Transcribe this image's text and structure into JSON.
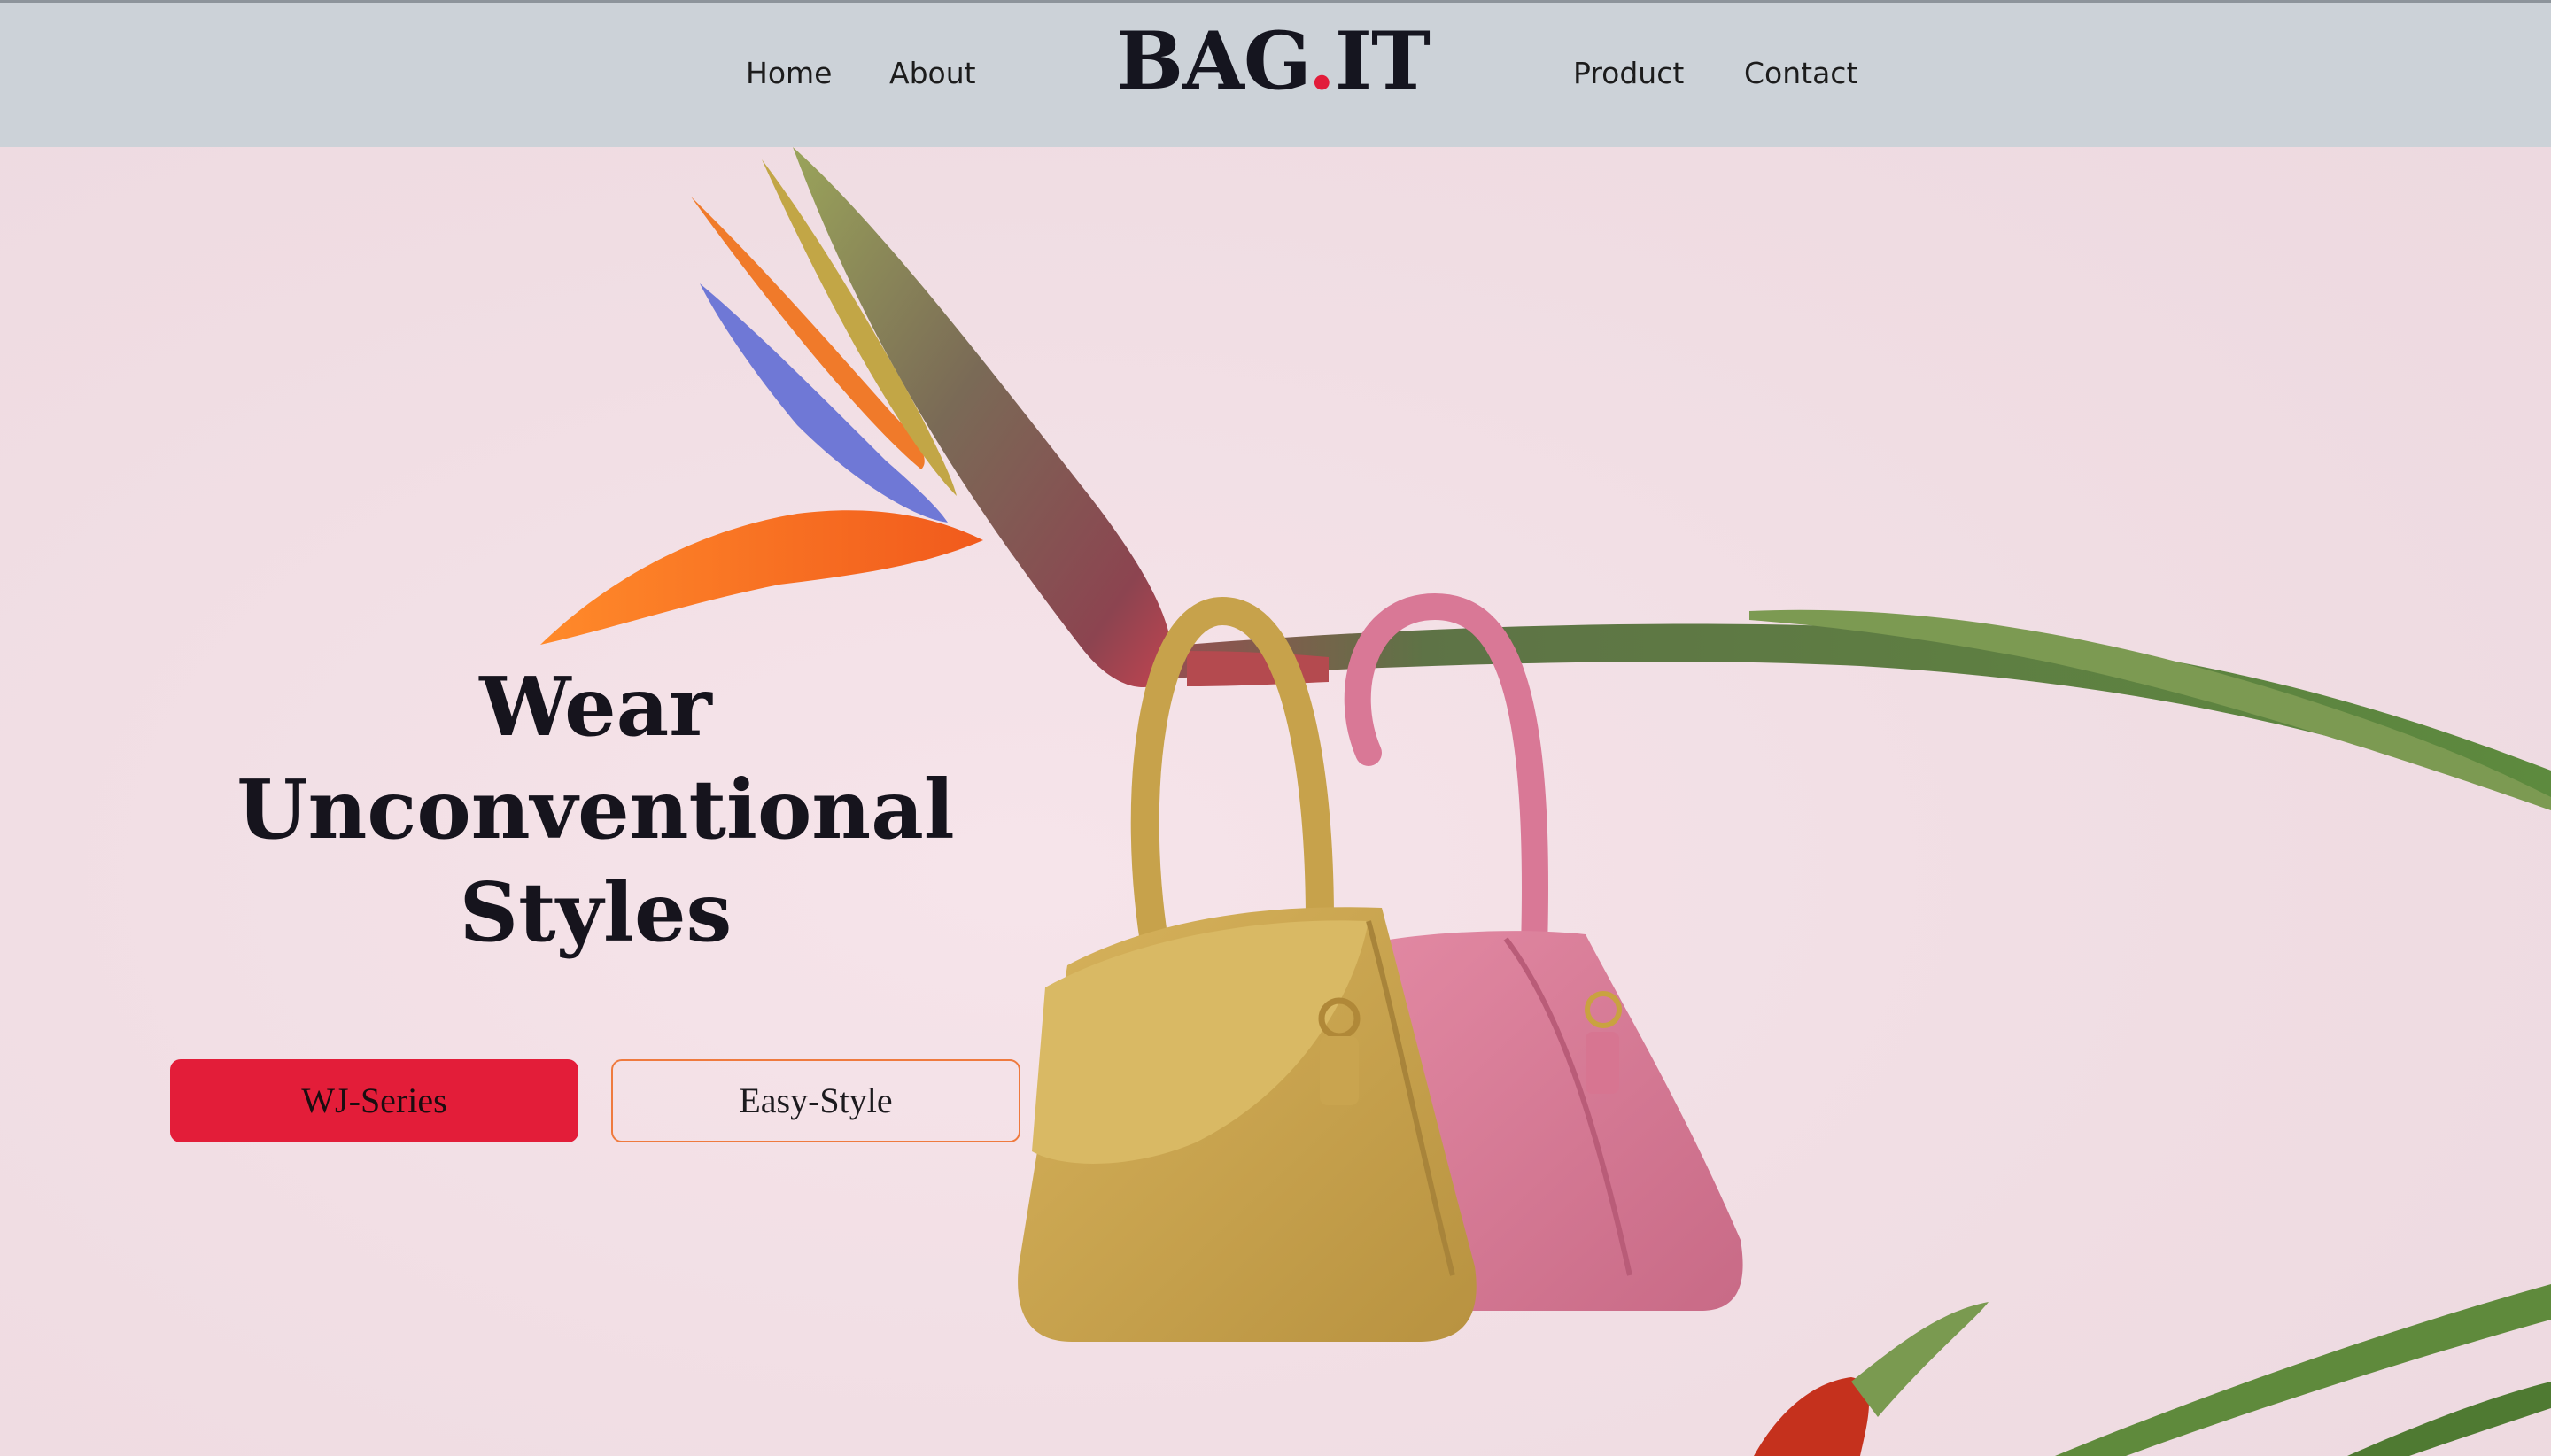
{
  "nav": {
    "left_links": [
      {
        "label": "Home"
      },
      {
        "label": "About"
      }
    ],
    "right_links": [
      {
        "label": "Product"
      },
      {
        "label": "Contact"
      }
    ],
    "logo": {
      "part1": "BAG",
      "dot": ".",
      "part2": "IT"
    }
  },
  "hero": {
    "title_lines": [
      "Wear",
      "Unconventional",
      "Styles"
    ],
    "primary_button": "WJ-Series",
    "secondary_button": "Easy-Style"
  },
  "colors": {
    "nav_background": "#ccd2d8",
    "hero_background": "#f1dfe4",
    "accent_red": "#e31d39",
    "outline_orange": "#ef7a3e",
    "text_dark": "#16141d"
  }
}
